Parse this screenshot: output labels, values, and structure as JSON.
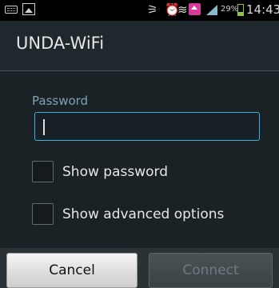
{
  "status_bar": {
    "battery_percent": "29%",
    "battery_level": 0.29,
    "time": "14:43",
    "icons": [
      "keyboard-icon",
      "image-icon",
      "nfc-icon",
      "alarm-icon",
      "wifi-icon",
      "home-icon",
      "signal-icon",
      "battery-icon"
    ]
  },
  "dialog": {
    "title": "UNDA-WiFi",
    "password_label": "Password",
    "password_value": "",
    "show_password_label": "Show password",
    "show_advanced_label": "Show advanced options",
    "cancel_label": "Cancel",
    "connect_label": "Connect"
  },
  "colors": {
    "accent": "#33b5e5",
    "label": "#7fa3b3"
  }
}
